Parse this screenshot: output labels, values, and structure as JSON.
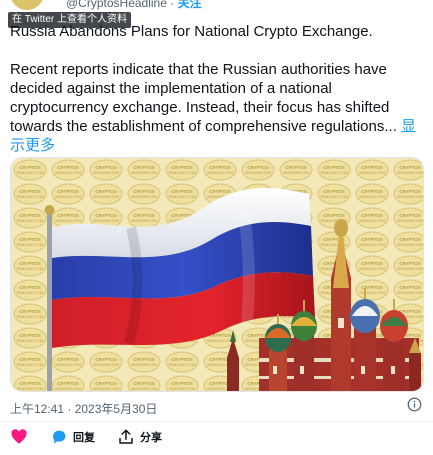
{
  "header": {
    "handle": "@CryptosHeadline",
    "separator": "·",
    "follow_label": "关注",
    "badge": "在 Twitter 上查看个人资料"
  },
  "tweet": {
    "title": "Russia Abandons Plans for National Crypto Exchange.",
    "body": "Recent reports indicate that the Russian authorities have decided against the implementation of a national cryptocurrency exchange. Instead, their focus has shifted towards the establishment of comprehensive regulations...",
    "show_more": "显示更多"
  },
  "media": {
    "watermark": "CRYPTOS HEADLINES.COM"
  },
  "meta": {
    "timestamp": "上午12:41 · 2023年5月30日"
  },
  "actions": {
    "reply_label": "回复",
    "share_label": "分享"
  },
  "colors": {
    "accent": "#1d9bf0",
    "like": "#f91880",
    "text": "#0f1419",
    "muted": "#536471"
  }
}
